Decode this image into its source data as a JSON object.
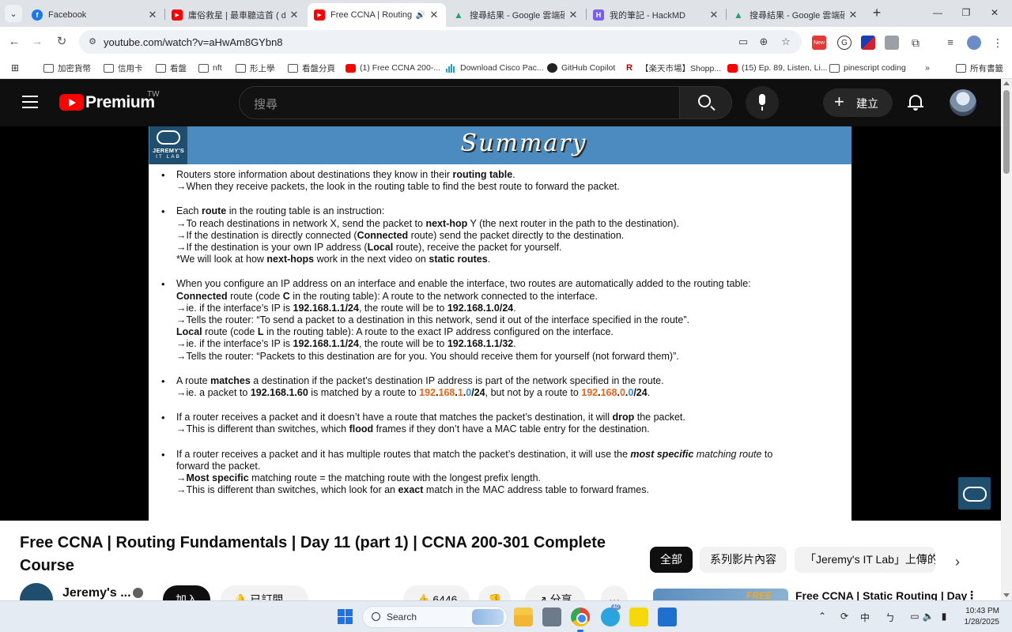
{
  "browser": {
    "tabs": [
      {
        "title": "Facebook",
        "icon": "facebook-icon",
        "color": "#1877f2",
        "glyph": "f"
      },
      {
        "title": "庸俗救星 | 最車聽這首 ( de",
        "icon": "youtube-favicon",
        "color": "#ff0000",
        "glyph": "▶"
      },
      {
        "title": "Free CCNA | Routing F",
        "icon": "youtube-favicon",
        "color": "#ff0000",
        "glyph": "▶",
        "active": true
      },
      {
        "title": "搜尋結果 - Google 雲端硬",
        "icon": "google-drive-icon",
        "color": "#1fa463",
        "glyph": "▲"
      },
      {
        "title": "我的筆記 - HackMD",
        "icon": "hackmd-icon",
        "color": "#7a5ef0",
        "glyph": "H"
      },
      {
        "title": "搜尋結果 - Google 雲端硬",
        "icon": "google-drive-icon",
        "color": "#1fa463",
        "glyph": "▲"
      }
    ],
    "url": "youtube.com/watch?v=aHwAm8GYbn8",
    "bookmarks": [
      {
        "label": "加密貨幣",
        "icon": "folder-icon"
      },
      {
        "label": "信用卡",
        "icon": "folder-icon"
      },
      {
        "label": "看盤",
        "icon": "folder-icon"
      },
      {
        "label": "nft",
        "icon": "folder-icon"
      },
      {
        "label": "形上學",
        "icon": "folder-icon"
      },
      {
        "label": "看盤分頁",
        "icon": "folder-icon"
      },
      {
        "label": "(1) Free CCNA 200-...",
        "icon": "youtube-icon"
      },
      {
        "label": "Download Cisco Pac...",
        "icon": "cisco-icon"
      },
      {
        "label": "GitHub Copilot",
        "icon": "github-icon"
      },
      {
        "label": "【楽天市場】Shopp...",
        "icon": "rakuten-icon"
      },
      {
        "label": "(15) Ep. 89, Listen, Li...",
        "icon": "youtube-icon"
      },
      {
        "label": "pinescript coding",
        "icon": "folder-icon"
      },
      {
        "label": "所有書籤",
        "icon": "folder-icon"
      }
    ],
    "new_badge": "New"
  },
  "youtube": {
    "brand": "Premium",
    "region": "TW",
    "search_placeholder": "搜尋",
    "create_label": "建立"
  },
  "slide": {
    "logo_line1": "JEREMY'S",
    "logo_line2": "IT LAB",
    "title": "Summary"
  },
  "video": {
    "title": "Free CCNA | Routing Fundamentals | Day 11 (part 1) | CCNA 200-301 Complete Course",
    "channel": "Jeremy's ...",
    "join_label": "加入",
    "subscribed_label": "已訂閱",
    "likes": "6446",
    "share_label": "分享",
    "more": "···"
  },
  "chips": [
    "全部",
    "系列影片內容",
    "「Jeremy's IT Lab」上傳的"
  ],
  "upnext": {
    "thumb_text": "FREE",
    "title": "Free CCNA | Static Routing | Day"
  },
  "taskbar": {
    "search_label": "Search",
    "tray_ime": "中",
    "time": "10:43 PM",
    "date": "1/28/2025",
    "badge_count": "40"
  }
}
